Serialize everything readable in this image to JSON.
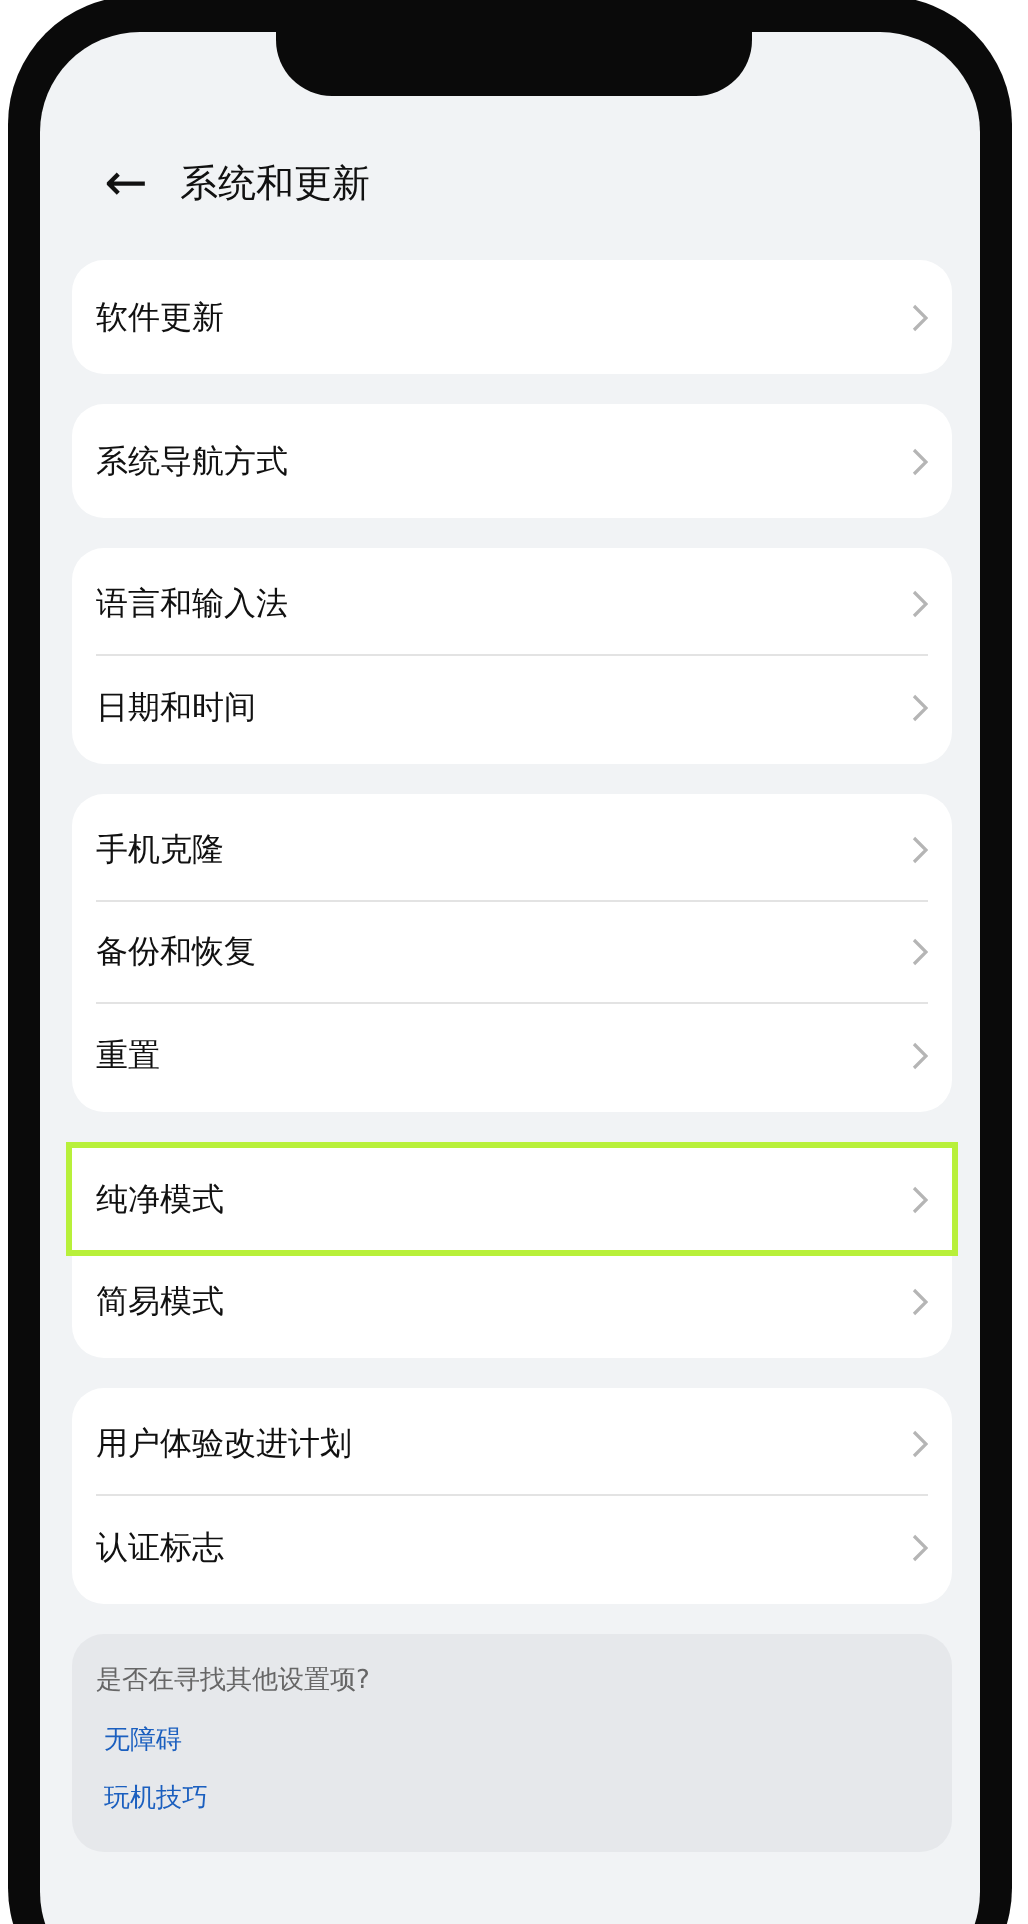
{
  "header": {
    "back": "←",
    "title": "系统和更新"
  },
  "groups": [
    {
      "items": [
        {
          "label": "软件更新",
          "highlighted": false
        }
      ]
    },
    {
      "items": [
        {
          "label": "系统导航方式",
          "highlighted": false
        }
      ]
    },
    {
      "items": [
        {
          "label": "语言和输入法",
          "highlighted": false
        },
        {
          "label": "日期和时间",
          "highlighted": false
        }
      ]
    },
    {
      "items": [
        {
          "label": "手机克隆",
          "highlighted": false
        },
        {
          "label": "备份和恢复",
          "highlighted": false
        },
        {
          "label": "重置",
          "highlighted": false
        }
      ]
    },
    {
      "items": [
        {
          "label": "纯净模式",
          "highlighted": true
        },
        {
          "label": "简易模式",
          "highlighted": false
        }
      ]
    },
    {
      "items": [
        {
          "label": "用户体验改进计划",
          "highlighted": false
        },
        {
          "label": "认证标志",
          "highlighted": false
        }
      ]
    }
  ],
  "suggestions": {
    "title": "是否在寻找其他设置项?",
    "links": [
      "无障碍",
      "玩机技巧"
    ]
  }
}
